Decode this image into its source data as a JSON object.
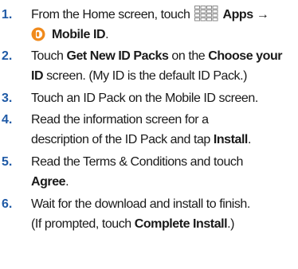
{
  "steps": [
    {
      "number": "1.",
      "line1_prefix": "From the Home screen, touch",
      "apps_label": "Apps",
      "arrow": "→",
      "mobile_id_label": "Mobile ID",
      "suffix": "."
    },
    {
      "number": "2.",
      "t1": "Touch ",
      "b1": "Get New ID Packs",
      "t2": " on the ",
      "b2": "Choose your",
      "b3": "ID",
      "t3": " screen. (My ID is the default ID Pack.)"
    },
    {
      "number": "3.",
      "text": "Touch an ID Pack on the Mobile ID screen."
    },
    {
      "number": "4.",
      "line1": "Read the information screen for a",
      "t1": "description of the ID Pack and tap ",
      "b1": "Install",
      "t2": "."
    },
    {
      "number": "5.",
      "line1": "Read the Terms & Conditions and touch",
      "b1": "Agree",
      "t1": "."
    },
    {
      "number": "6.",
      "line1": "Wait for the download and install to finish.",
      "t1": "(If prompted, touch ",
      "b1": "Complete Install",
      "t2": ".)"
    }
  ],
  "icons": {
    "apps": "apps-grid-icon",
    "mobile_id": "mobile-id-icon"
  },
  "colors": {
    "step_number": "#1f5aa6",
    "body_text": "#1a1a1a",
    "icon_gray": "#8a8a8a",
    "mobile_id_orange": "#f08a1c"
  }
}
